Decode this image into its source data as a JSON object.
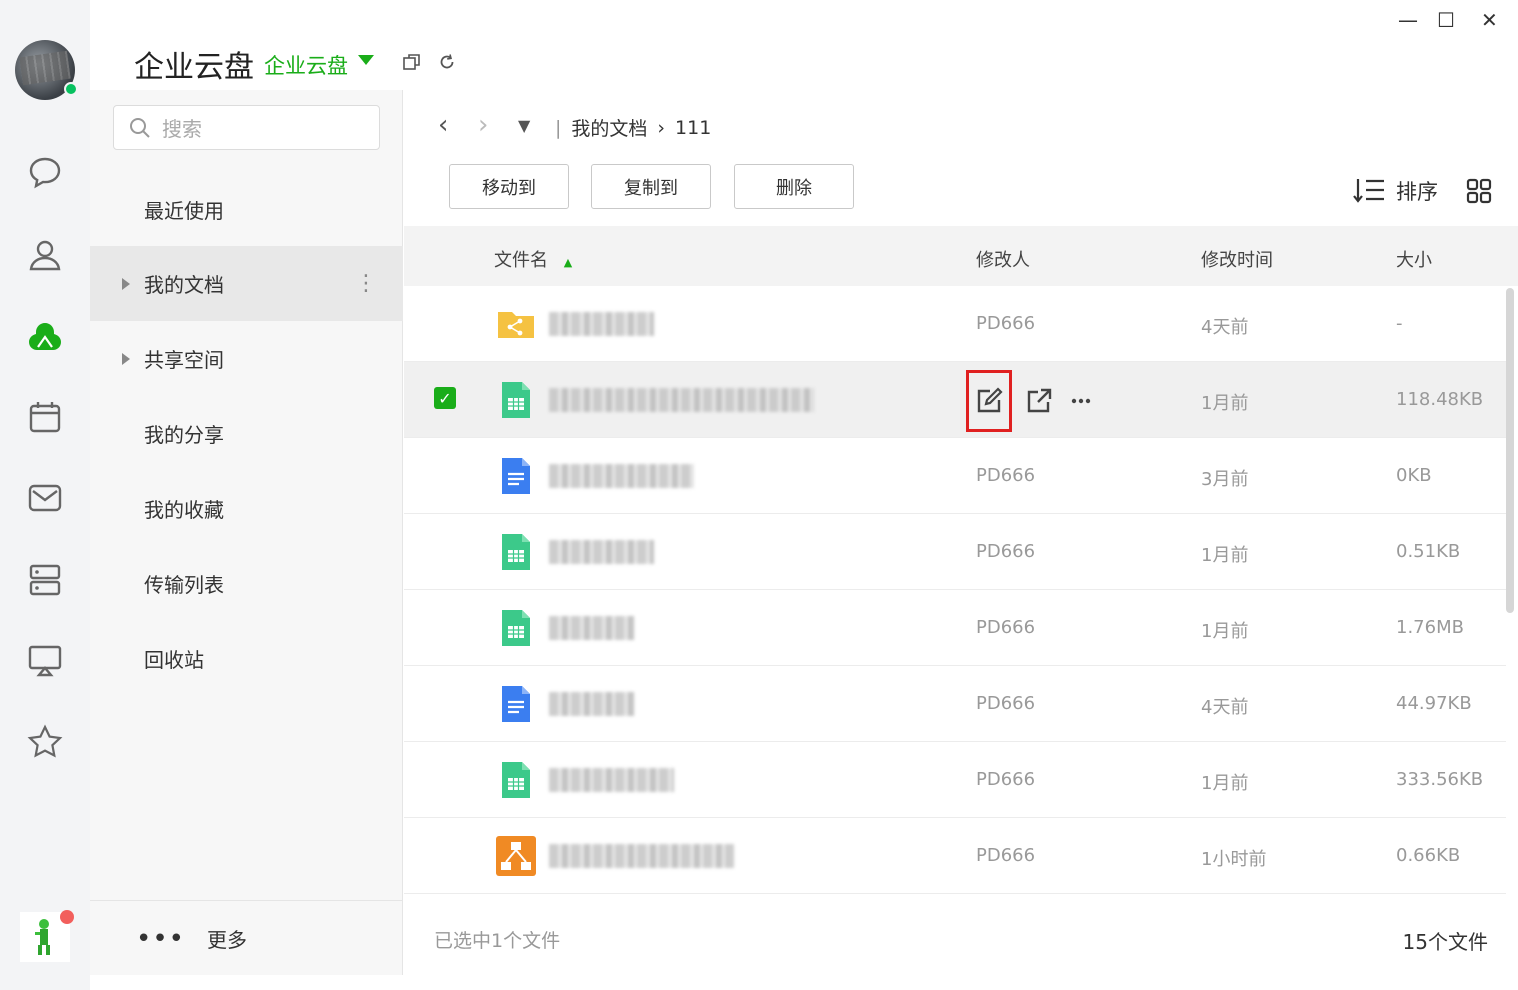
{
  "app": {
    "title": "企业云盘",
    "space_selector": "企业云盘"
  },
  "window_controls": {
    "minimize": "—",
    "maximize": "☐",
    "close": "✕"
  },
  "search": {
    "placeholder": "搜索"
  },
  "sidebar": {
    "items": [
      {
        "label": "最近使用"
      },
      {
        "label": "我的文档"
      },
      {
        "label": "共享空间"
      },
      {
        "label": "我的分享"
      },
      {
        "label": "我的收藏"
      },
      {
        "label": "传输列表"
      },
      {
        "label": "回收站"
      }
    ],
    "more": "更多"
  },
  "breadcrumb": {
    "root": "我的文档",
    "current": "111"
  },
  "toolbar": {
    "move": "移动到",
    "copy": "复制到",
    "delete": "删除",
    "sort": "排序"
  },
  "table": {
    "headers": {
      "name": "文件名",
      "modifier": "修改人",
      "time": "修改时间",
      "size": "大小"
    },
    "rows": [
      {
        "type": "shared-folder",
        "modifier": "PD666",
        "time": "4天前",
        "size": "-",
        "selected": false
      },
      {
        "type": "sheet",
        "modifier": "",
        "time": "1月前",
        "size": "118.48KB",
        "selected": true
      },
      {
        "type": "doc",
        "modifier": "PD666",
        "time": "3月前",
        "size": "0KB",
        "selected": false
      },
      {
        "type": "sheet",
        "modifier": "PD666",
        "time": "1月前",
        "size": "0.51KB",
        "selected": false
      },
      {
        "type": "sheet",
        "modifier": "PD666",
        "time": "1月前",
        "size": "1.76MB",
        "selected": false
      },
      {
        "type": "doc",
        "modifier": "PD666",
        "time": "4天前",
        "size": "44.97KB",
        "selected": false
      },
      {
        "type": "sheet",
        "modifier": "PD666",
        "time": "1月前",
        "size": "333.56KB",
        "selected": false
      },
      {
        "type": "drawio",
        "modifier": "PD666",
        "time": "1小时前",
        "size": "0.66KB",
        "selected": false
      }
    ]
  },
  "footer": {
    "selected_text": "已选中1个文件",
    "total_text": "15个文件"
  },
  "colors": {
    "accent": "#1aad19",
    "online": "#07c160",
    "highlight": "#e02020",
    "sheet": "#3cc98a",
    "doc": "#3b7ef0",
    "folder": "#f5c242",
    "drawio": "#f08a24"
  }
}
